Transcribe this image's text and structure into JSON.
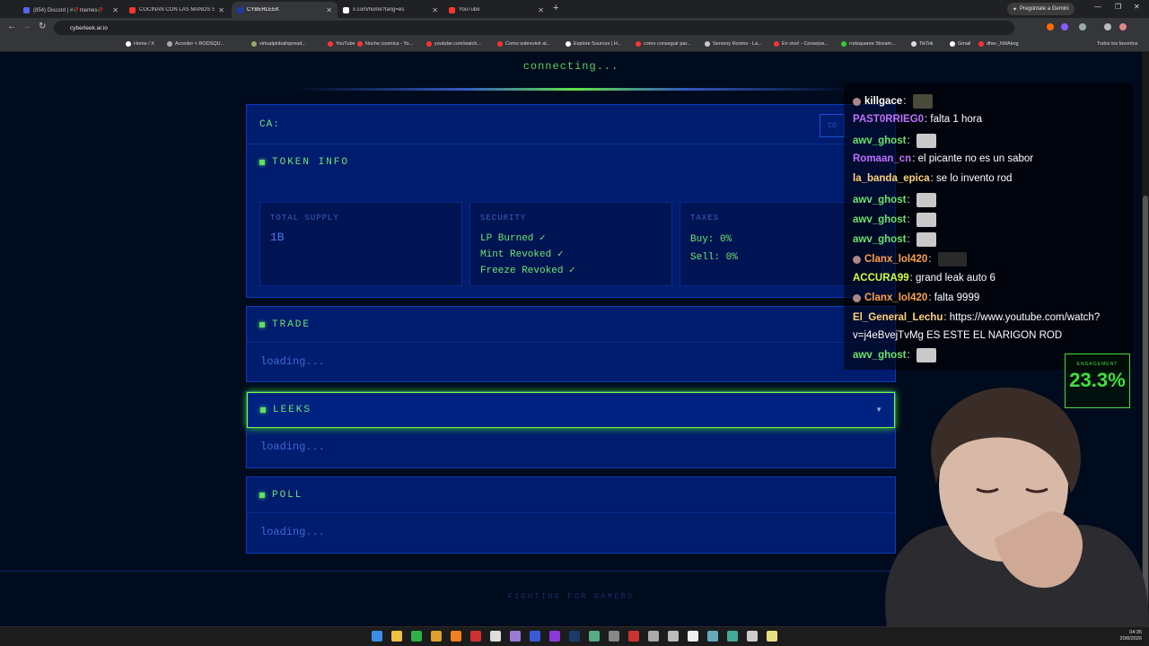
{
  "browser": {
    "tabs": [
      {
        "label": "(854) Discord | #🥀memes🥀",
        "color": "#5865f2"
      },
      {
        "label": "COCINAN CON LAS MANOS SI...",
        "color": "#ff3333"
      },
      {
        "label": "CYBERLEEK",
        "color": "#1a3aa8"
      },
      {
        "label": "x.com/home?lang=es",
        "color": "#ffffff"
      },
      {
        "label": "YouTube",
        "color": "#ff3333"
      }
    ],
    "gemini_label": "Pregúntale a Gemini",
    "url": "cyberleek.ar.io",
    "bookmarks": [
      "Home / X",
      "Acceder < RODSQU...",
      "virtualpinballspread...",
      "YouTube",
      "Noche cosmica - Yo...",
      "youtube.com/watch...",
      "Como sobrevivir al...",
      "Explore Sources | H...",
      "como conseguir par...",
      "Sensory Rooms - La...",
      "En vivo! - Consejos...",
      "rodsquaree Stream...",
      "TikTok",
      "Gmail",
      "dhw-_hWAkog"
    ],
    "all_bookmarks": "Todos los favoritos"
  },
  "page": {
    "status": "connecting...",
    "ca_label": "CA:",
    "copy_label": "CO",
    "token_info": {
      "title": "TOKEN INFO",
      "total_supply_label": "TOTAL SUPPLY",
      "total_supply_value": "1B",
      "security_label": "SECURITY",
      "security_items": [
        "LP Burned ✓",
        "Mint Revoked ✓",
        "Freeze Revoked ✓"
      ],
      "taxes_label": "TAXES",
      "tax_buy": "Buy: 0%",
      "tax_sell": "Sell: 0%"
    },
    "trade": {
      "title": "TRADE",
      "body": "loading..."
    },
    "leeks": {
      "title": "LEEKS",
      "body": "loading..."
    },
    "poll": {
      "title": "POLL",
      "body": "loading..."
    },
    "footer": "FIGHTING FOR GAMERS"
  },
  "chat": [
    {
      "user": "killgace",
      "text": "",
      "color": "#ffffff",
      "emote": "dark"
    },
    {
      "user": "PAST0RRIEG0",
      "text": "falta 1 hora",
      "color": "#c070ff",
      "emote": ""
    },
    {
      "user": "awv_ghost",
      "text": "",
      "color": "#6fe36f",
      "emote": "light"
    },
    {
      "user": "Romaan_cn",
      "text": "el picante no es un sabor",
      "color": "#c070ff",
      "emote": ""
    },
    {
      "user": "la_banda_epica",
      "text": "se lo invento rod",
      "color": "#ffd27a",
      "emote": ""
    },
    {
      "user": "awv_ghost",
      "text": "",
      "color": "#6fe36f",
      "emote": "light"
    },
    {
      "user": "awv_ghost",
      "text": "",
      "color": "#6fe36f",
      "emote": "light"
    },
    {
      "user": "awv_ghost",
      "text": "",
      "color": "#6fe36f",
      "emote": "light"
    },
    {
      "user": "Clanx_lol420",
      "text": "",
      "color": "#ffa24a",
      "emote": "wide"
    },
    {
      "user": "ACCURA99",
      "text": "grand leak auto 6",
      "color": "#d4ff3a",
      "emote": ""
    },
    {
      "user": "Clanx_lol420",
      "text": "falta 9999",
      "color": "#ffa24a",
      "emote": ""
    },
    {
      "user": "El_General_Lechu",
      "text": "https://www.youtube.com/watch?",
      "color": "#ffd27a",
      "emote": ""
    },
    {
      "user": "",
      "text": "v=j4eBvejTvMg ES ESTE EL NARIGON ROD",
      "color": "#ffffff",
      "emote": ""
    },
    {
      "user": "awv_ghost",
      "text": "",
      "color": "#6fe36f",
      "emote": "light"
    }
  ],
  "engagement": {
    "label": "ENGAGEMENT",
    "value": "23.3%"
  },
  "taskbar": {
    "time": "04:35",
    "date": "20/8/2026"
  }
}
